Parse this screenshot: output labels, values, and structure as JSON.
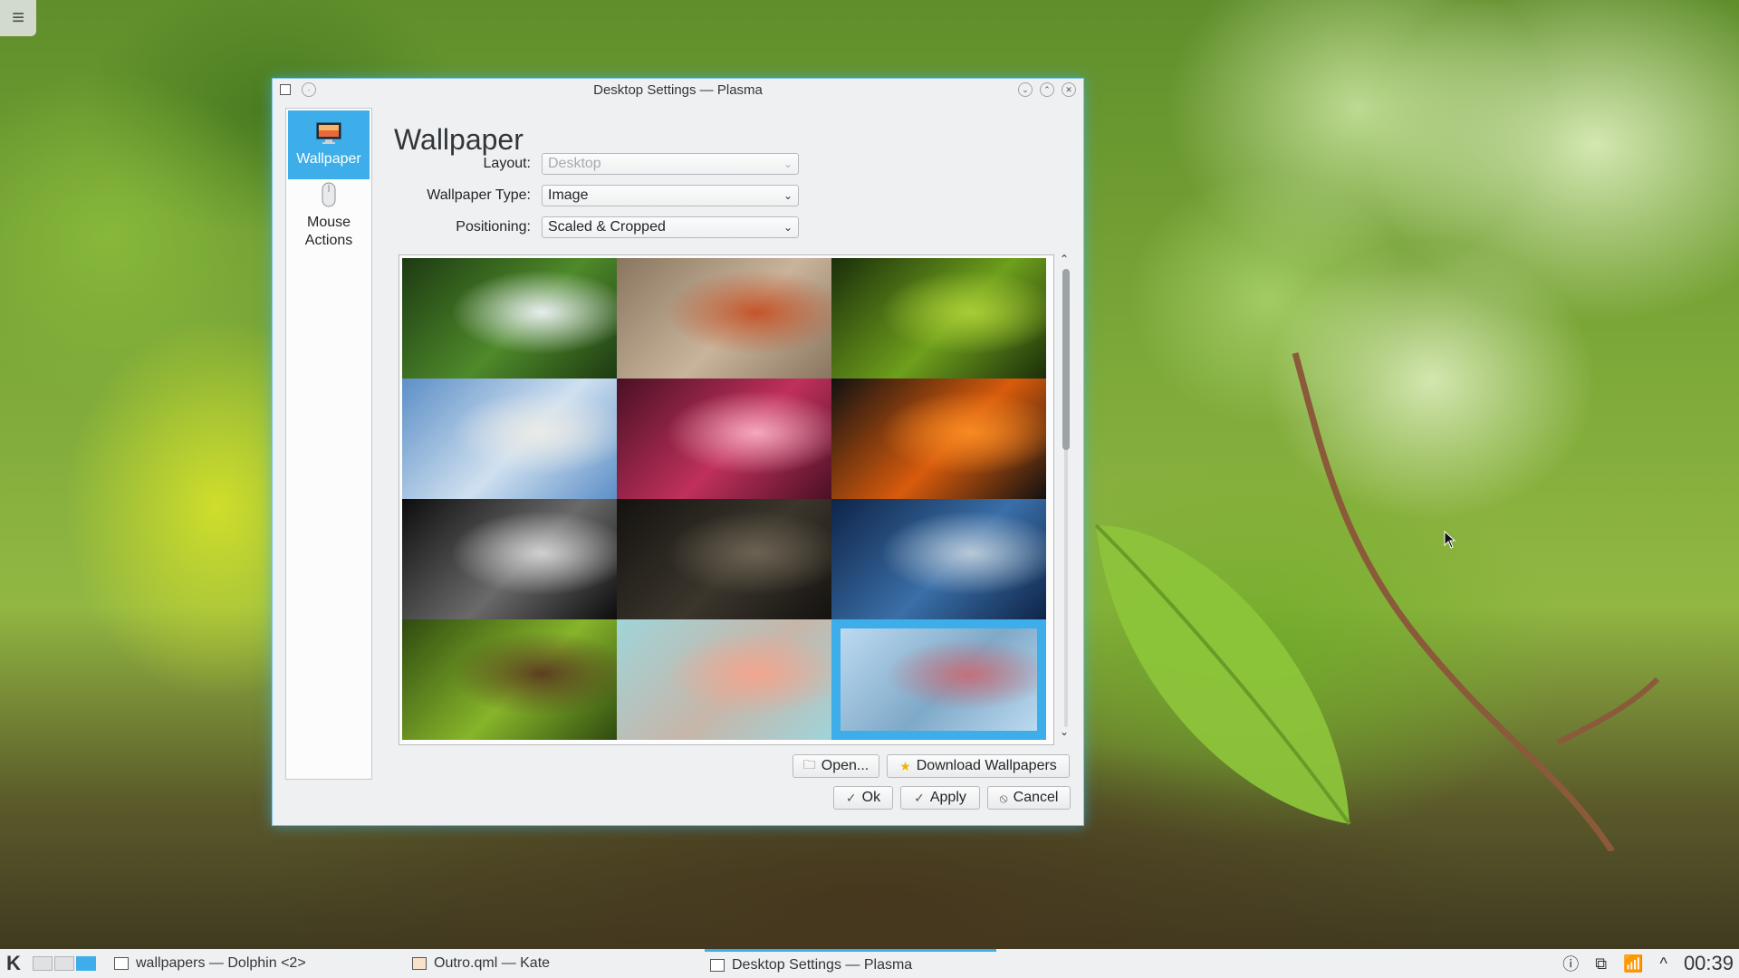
{
  "desktop": {
    "menu_icon": "hamburger-icon"
  },
  "dialog": {
    "title": "Desktop Settings — Plasma",
    "heading": "Wallpaper",
    "sidebar": {
      "items": [
        {
          "label": "Wallpaper",
          "icon": "monitor-icon",
          "active": true
        },
        {
          "label": "Mouse\nActions",
          "icon": "mouse-icon",
          "active": false
        }
      ]
    },
    "form": {
      "layout_label": "Layout:",
      "layout_value": "Desktop",
      "wallpaper_type_label": "Wallpaper Type:",
      "wallpaper_type_value": "Image",
      "positioning_label": "Positioning:",
      "positioning_value": "Scaled & Cropped"
    },
    "wallpapers": [
      {
        "name": "white-flower-wallpaper",
        "colors": [
          "#1d3a12",
          "#4e8a2a",
          "#e8eef0"
        ]
      },
      {
        "name": "lizard-wallpaper",
        "colors": [
          "#8a7560",
          "#c9b49b",
          "#c4552a"
        ]
      },
      {
        "name": "green-leaf-wallpaper",
        "colors": [
          "#1a2e0a",
          "#6e9f1c",
          "#a9cc35"
        ]
      },
      {
        "name": "beach-palm-wallpaper",
        "colors": [
          "#5c8fc7",
          "#cfe0f0",
          "#e9eae6"
        ]
      },
      {
        "name": "pink-flower-wallpaper",
        "colors": [
          "#4a1024",
          "#c0305c",
          "#f4a7bd"
        ]
      },
      {
        "name": "orange-leaf-wallpaper",
        "colors": [
          "#111111",
          "#d85b0c",
          "#f78a22"
        ]
      },
      {
        "name": "keyboard-wallpaper",
        "colors": [
          "#0d0d0d",
          "#6a6a6a",
          "#d0d0d0"
        ]
      },
      {
        "name": "dew-leaf-wallpaper",
        "colors": [
          "#141210",
          "#3b362c",
          "#6b6252"
        ]
      },
      {
        "name": "blue-wave-wallpaper",
        "colors": [
          "#0e2448",
          "#3a6fa8",
          "#b8c9d8"
        ]
      },
      {
        "name": "green-plants-wallpaper",
        "colors": [
          "#2f4a10",
          "#86b52a",
          "#5c3e20"
        ]
      },
      {
        "name": "pastel-geometric-wallpaper",
        "colors": [
          "#9fd4d9",
          "#c7b6a9",
          "#f1a68f"
        ]
      },
      {
        "name": "grass-plume-wallpaper",
        "colors": [
          "#bcdaf0",
          "#7fa9c8",
          "#c4707a"
        ],
        "selected": true
      }
    ],
    "buttons": {
      "open": "Open...",
      "download": "Download Wallpapers",
      "ok": "Ok",
      "apply": "Apply",
      "cancel": "Cancel"
    }
  },
  "taskbar": {
    "tasks": [
      {
        "label": "wallpapers — Dolphin <2>",
        "icon": "folder-icon"
      },
      {
        "label": "Outro.qml  — Kate",
        "icon": "text-editor-icon"
      },
      {
        "label": "Desktop Settings — Plasma",
        "icon": "settings-window-icon",
        "active": true
      }
    ],
    "clock": "00:39"
  },
  "colors": {
    "accent": "#3daee9",
    "window_bg": "#eff0f1"
  }
}
